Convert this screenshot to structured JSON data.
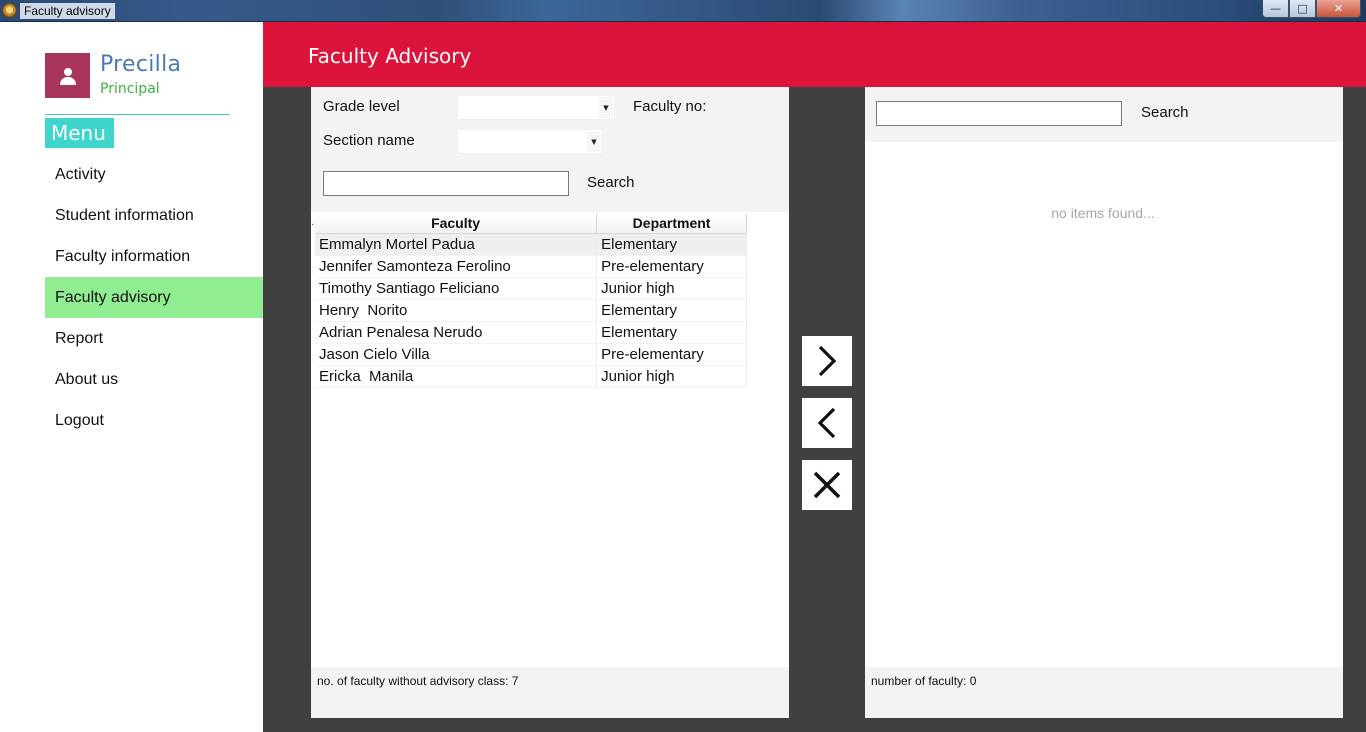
{
  "window": {
    "title": "Faculty advisory",
    "minimize_symbol": "—",
    "maximize_symbol": "□",
    "close_symbol": "✕"
  },
  "user": {
    "name": "Precilla",
    "role": "Principal",
    "avatar_icon": "user-icon"
  },
  "sidebar": {
    "menu_title": "Menu",
    "items": [
      {
        "label": "Activity"
      },
      {
        "label": "Student information"
      },
      {
        "label": "Faculty information"
      },
      {
        "label": "Faculty advisory",
        "active": true
      },
      {
        "label": "Report"
      },
      {
        "label": "About us"
      },
      {
        "label": "Logout"
      }
    ]
  },
  "header": {
    "title": "Faculty Advisory"
  },
  "filters": {
    "grade_level_label": "Grade level",
    "faculty_no_label": "Faculty no:",
    "section_name_label": "Section name",
    "grade_level_value": "",
    "section_name_value": "",
    "search_value": "",
    "search_label": "Search"
  },
  "faculty_table": {
    "columns": [
      "Faculty",
      "Department"
    ],
    "rows": [
      [
        "Emmalyn Mortel Padua",
        "Elementary"
      ],
      [
        "Jennifer Samonteza Ferolino",
        "Pre-elementary"
      ],
      [
        "Timothy Santiago Feliciano",
        "Junior high"
      ],
      [
        "Henry  Norito",
        "Elementary"
      ],
      [
        "Adrian Penalesa Nerudo",
        "Elementary"
      ],
      [
        "Jason Cielo Villa",
        "Pre-elementary"
      ],
      [
        "Ericka  Manila",
        "Junior high"
      ]
    ],
    "selected_row_marker": "."
  },
  "left_footer": {
    "text": "no. of faculty without advisory class: 7"
  },
  "transfer_buttons": {
    "add_icon": "chevron-right-icon",
    "remove_icon": "chevron-left-icon",
    "clear_icon": "close-icon"
  },
  "right_panel": {
    "search_value": "",
    "search_label": "Search",
    "empty_message": "no items found...",
    "footer_text": "number of faculty: 0"
  },
  "colors": {
    "header": "#dc143c",
    "menu_head": "#3fd4cc",
    "active_item": "#90ee90",
    "avatar": "#a8365c",
    "user_name": "#4a79b9",
    "user_role": "#3db23d",
    "dark_bg": "#404040"
  }
}
